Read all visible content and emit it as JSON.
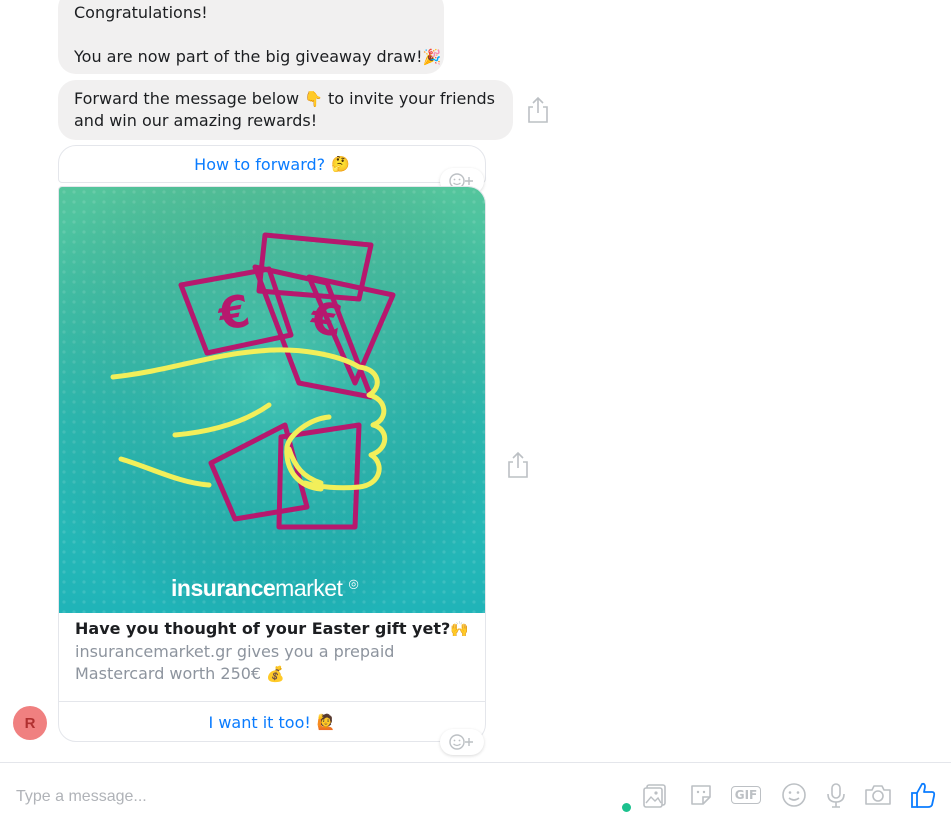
{
  "messages": [
    {
      "lines": [
        "Congratulations!",
        "You are now part of the big giveaway draw!"
      ],
      "emoji": "🎉"
    },
    {
      "line1_text": "Forward the message below",
      "line1_emoji": "👇",
      "line1_tail": "to invite your friends",
      "line2": "and win our amazing rewards!"
    }
  ],
  "how_to_button": {
    "label": "How to forward?",
    "emoji": "🤔"
  },
  "card": {
    "brand_bold": "insurance",
    "brand_light": "market",
    "title": "Have you thought of your Easter gift yet?",
    "title_emoji": "🙌",
    "description": "insurancemarket.gr gives you a prepaid Mastercard worth 250€",
    "description_emoji": "💰",
    "cta_label": "I want it too!",
    "cta_emoji": "🙋"
  },
  "avatar": {
    "initial": "R"
  },
  "composer": {
    "placeholder": "Type a message...",
    "tools": [
      "image-icon",
      "sticker-icon",
      "gif-icon",
      "emoji-icon",
      "microphone-icon",
      "camera-icon",
      "thumbs-up-icon"
    ],
    "gif_label": "GIF"
  },
  "colors": {
    "accent": "#0a7cff",
    "bubble": "#f1f0f0",
    "online": "#1cc18e"
  }
}
